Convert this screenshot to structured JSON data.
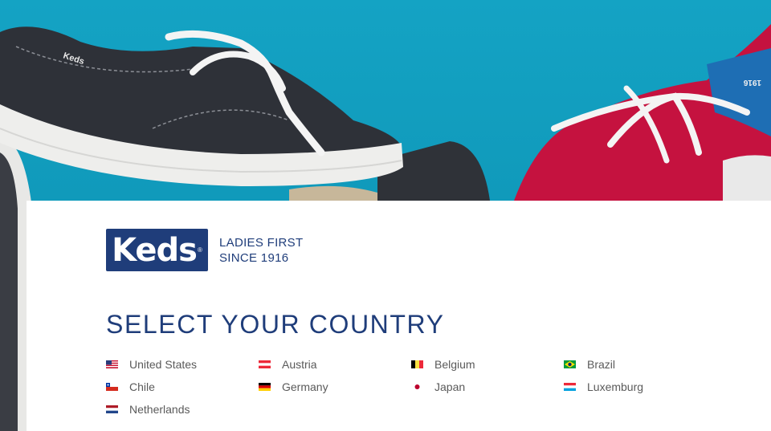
{
  "brand": {
    "logo_text": "Keds",
    "logo_mark": "®",
    "tagline_line1": "LADIES FIRST",
    "tagline_line2": "SINCE 1916",
    "color": "#1f3d7a"
  },
  "heading": "SELECT YOUR COUNTRY",
  "countries": [
    {
      "name": "United States",
      "flag": "us-flag-icon"
    },
    {
      "name": "Austria",
      "flag": "austria-flag-icon"
    },
    {
      "name": "Belgium",
      "flag": "belgium-flag-icon"
    },
    {
      "name": "Brazil",
      "flag": "brazil-flag-icon"
    },
    {
      "name": "Chile",
      "flag": "chile-flag-icon"
    },
    {
      "name": "Germany",
      "flag": "germany-flag-icon"
    },
    {
      "name": "Japan",
      "flag": "japan-flag-icon"
    },
    {
      "name": "Luxemburg",
      "flag": "luxemburg-flag-icon"
    },
    {
      "name": "Netherlands",
      "flag": "netherlands-flag-icon"
    }
  ],
  "hero": {
    "shoe_stamp": "Keds",
    "shoe_heel_text": "1916"
  },
  "colors": {
    "background_teal": "#0f97b8",
    "text_gray": "#5a5a5a"
  }
}
